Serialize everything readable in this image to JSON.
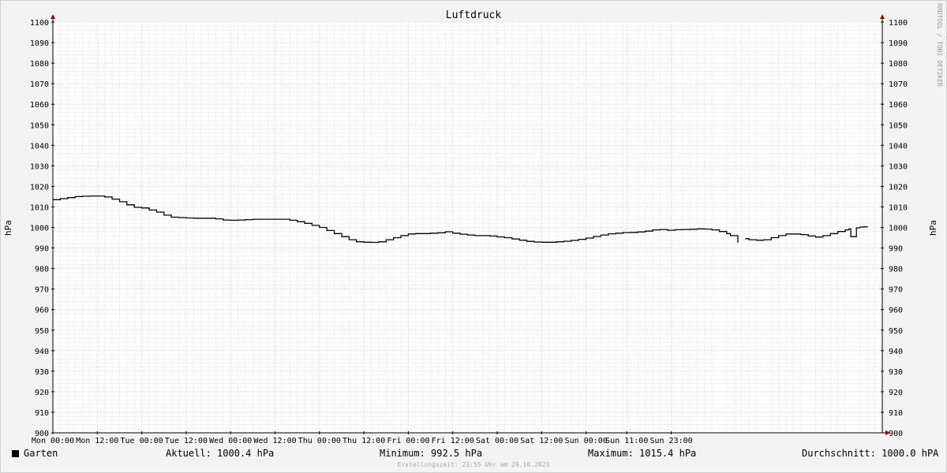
{
  "chart_data": {
    "type": "line",
    "title": "Luftdruck",
    "ylabel": "hPa",
    "ylim": [
      900,
      1100
    ],
    "y_ticks": [
      900,
      910,
      920,
      930,
      940,
      950,
      960,
      970,
      980,
      990,
      1000,
      1010,
      1020,
      1030,
      1040,
      1050,
      1060,
      1070,
      1080,
      1090,
      1100
    ],
    "x_tick_labels": [
      "Mon 00:00",
      "Mon 12:00",
      "Tue 00:00",
      "Tue 12:00",
      "Wed 00:00",
      "Wed 12:00",
      "Thu 00:00",
      "Thu 12:00",
      "Fri 00:00",
      "Fri 12:00",
      "Sat 00:00",
      "Sat 12:00",
      "Sun 00:00",
      "Sun 11:00",
      "Sun 23:00"
    ],
    "x_unit": "hours since Mon 00:00",
    "grid": true,
    "legend_position": "bottom-left",
    "series": [
      {
        "name": "Garten",
        "color": "#000000",
        "points": [
          [
            0,
            1013.5
          ],
          [
            2,
            1014.0
          ],
          [
            4,
            1014.5
          ],
          [
            6,
            1015.0
          ],
          [
            8,
            1015.2
          ],
          [
            10,
            1015.3
          ],
          [
            12,
            1015.3
          ],
          [
            14,
            1014.8
          ],
          [
            16,
            1013.8
          ],
          [
            18,
            1012.5
          ],
          [
            20,
            1011.0
          ],
          [
            22,
            1009.8
          ],
          [
            24,
            1009.5
          ],
          [
            26,
            1008.5
          ],
          [
            28,
            1007.5
          ],
          [
            30,
            1006.0
          ],
          [
            32,
            1005.0
          ],
          [
            34,
            1004.8
          ],
          [
            36,
            1004.6
          ],
          [
            38,
            1004.5
          ],
          [
            40,
            1004.5
          ],
          [
            42,
            1004.5
          ],
          [
            44,
            1004.2
          ],
          [
            46,
            1003.6
          ],
          [
            48,
            1003.5
          ],
          [
            50,
            1003.6
          ],
          [
            52,
            1003.8
          ],
          [
            54,
            1004.0
          ],
          [
            56,
            1004.0
          ],
          [
            58,
            1004.0
          ],
          [
            60,
            1004.0
          ],
          [
            62,
            1004.0
          ],
          [
            64,
            1003.5
          ],
          [
            66,
            1002.8
          ],
          [
            68,
            1002.0
          ],
          [
            70,
            1001.0
          ],
          [
            72,
            1000.0
          ],
          [
            74,
            998.5
          ],
          [
            76,
            997.0
          ],
          [
            78,
            995.5
          ],
          [
            80,
            994.0
          ],
          [
            82,
            993.0
          ],
          [
            84,
            992.8
          ],
          [
            86,
            992.7
          ],
          [
            88,
            993.0
          ],
          [
            90,
            994.0
          ],
          [
            92,
            995.0
          ],
          [
            94,
            996.0
          ],
          [
            96,
            996.8
          ],
          [
            98,
            997.0
          ],
          [
            100,
            997.0
          ],
          [
            102,
            997.2
          ],
          [
            104,
            997.4
          ],
          [
            106,
            997.9
          ],
          [
            108,
            997.2
          ],
          [
            110,
            996.7
          ],
          [
            112,
            996.3
          ],
          [
            114,
            996.0
          ],
          [
            116,
            996.0
          ],
          [
            118,
            995.8
          ],
          [
            120,
            995.4
          ],
          [
            122,
            995.0
          ],
          [
            124,
            994.4
          ],
          [
            126,
            993.8
          ],
          [
            128,
            993.2
          ],
          [
            130,
            992.9
          ],
          [
            132,
            992.8
          ],
          [
            134,
            992.8
          ],
          [
            136,
            993.0
          ],
          [
            138,
            993.3
          ],
          [
            140,
            993.7
          ],
          [
            142,
            994.2
          ],
          [
            144,
            994.8
          ],
          [
            146,
            995.6
          ],
          [
            148,
            996.3
          ],
          [
            150,
            996.9
          ],
          [
            152,
            997.2
          ],
          [
            154,
            997.5
          ],
          [
            156,
            997.6
          ],
          [
            158,
            997.8
          ],
          [
            160,
            998.2
          ],
          [
            162,
            998.8
          ],
          [
            164,
            999.0
          ],
          [
            166,
            998.6
          ],
          [
            168,
            998.9
          ],
          [
            170,
            999.0
          ],
          [
            172,
            999.1
          ],
          [
            174,
            999.3
          ],
          [
            176,
            999.2
          ],
          [
            178,
            998.8
          ],
          [
            180,
            998.0
          ],
          [
            182,
            997.0
          ],
          [
            183,
            996.0
          ],
          [
            184.5,
            996.0
          ],
          [
            185,
            992.5
          ],
          [
            186,
            null
          ],
          [
            187,
            994.5
          ],
          [
            188,
            994.0
          ],
          [
            190,
            993.8
          ],
          [
            192,
            994.0
          ],
          [
            194,
            995.0
          ],
          [
            196,
            996.0
          ],
          [
            198,
            996.8
          ],
          [
            200,
            996.8
          ],
          [
            202,
            996.5
          ],
          [
            204,
            995.8
          ],
          [
            206,
            995.3
          ],
          [
            208,
            996.0
          ],
          [
            210,
            997.0
          ],
          [
            212,
            998.0
          ],
          [
            214,
            998.8
          ],
          [
            215,
            999.3
          ],
          [
            215.5,
            995.5
          ],
          [
            216.5,
            995.5
          ],
          [
            217,
            999.8
          ],
          [
            218,
            1000.2
          ],
          [
            219,
            1000.3
          ],
          [
            220,
            1000.4
          ]
        ]
      }
    ]
  },
  "legend": {
    "series_name": "Garten",
    "current": "Aktuell: 1000.4 hPa",
    "minimum": "Minimum: 992.5 hPa",
    "maximum": "Maximum: 1015.4 hPa",
    "average": "Durchschnitt: 1000.0 hPA"
  },
  "watermark": "RRDTOOL / TOBI OETIKER",
  "footer": "Erstellungszeit: 23:55 Uhr am 29.10.2023"
}
